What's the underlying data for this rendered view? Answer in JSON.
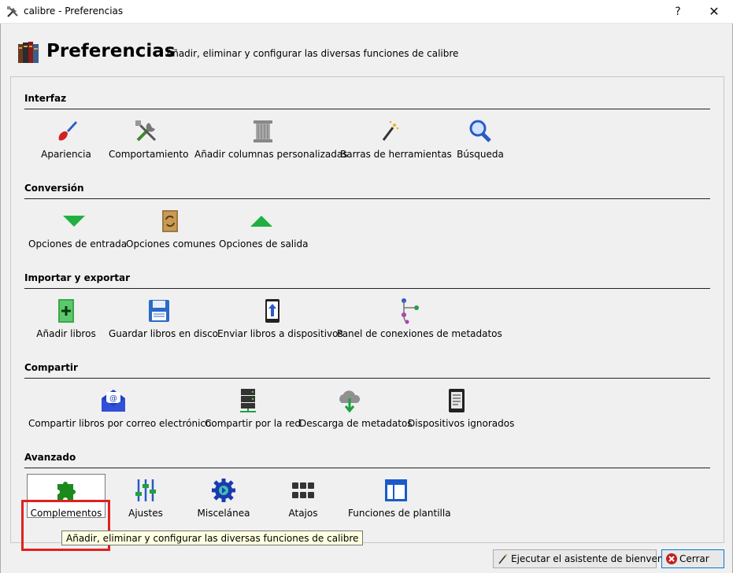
{
  "window": {
    "title": "calibre - Preferencias",
    "help_label": "?",
    "close_label": "✕"
  },
  "header": {
    "heading": "Preferencias",
    "subtitle": "Añadir, eliminar y configurar las diversas funciones de calibre"
  },
  "sections": [
    {
      "title": "Interfaz",
      "items": [
        {
          "label": "Apariencia",
          "icon": "paintbrush-icon"
        },
        {
          "label": "Comportamiento",
          "icon": "tools-icon"
        },
        {
          "label": "Añadir columnas personalizadas",
          "icon": "column-icon"
        },
        {
          "label": "Barras de herramientas",
          "icon": "magic-wand-icon"
        },
        {
          "label": "Búsqueda",
          "icon": "search-icon"
        }
      ]
    },
    {
      "title": "Conversión",
      "items": [
        {
          "label": "Opciones de entrada",
          "icon": "arrow-down-icon"
        },
        {
          "label": "Opciones comunes",
          "icon": "convert-icon"
        },
        {
          "label": "Opciones de salida",
          "icon": "arrow-up-icon"
        }
      ]
    },
    {
      "title": "Importar y exportar",
      "items": [
        {
          "label": "Añadir libros",
          "icon": "add-book-icon"
        },
        {
          "label": "Guardar libros en disco",
          "icon": "floppy-icon"
        },
        {
          "label": "Enviar libros a dispositivos",
          "icon": "send-device-icon"
        },
        {
          "label": "Panel de conexiones de metadatos",
          "icon": "plugboard-icon"
        }
      ]
    },
    {
      "title": "Compartir",
      "items": [
        {
          "label": "Compartir libros por correo electrónico",
          "icon": "email-icon"
        },
        {
          "label": "Compartir por la red",
          "icon": "server-icon"
        },
        {
          "label": "Descarga de metadatos",
          "icon": "cloud-download-icon"
        },
        {
          "label": "Dispositivos ignorados",
          "icon": "device-icon"
        }
      ]
    },
    {
      "title": "Avanzado",
      "items": [
        {
          "label": "Complementos",
          "icon": "puzzle-icon"
        },
        {
          "label": "Ajustes",
          "icon": "sliders-icon"
        },
        {
          "label": "Miscelánea",
          "icon": "gear-icon"
        },
        {
          "label": "Atajos",
          "icon": "keyboard-icon"
        },
        {
          "label": "Funciones de plantilla",
          "icon": "template-icon"
        }
      ]
    }
  ],
  "tooltip": "Añadir, eliminar y configurar las diversas funciones de calibre",
  "footer": {
    "wizard_label": "Ejecutar el asistente de bienvenida",
    "close_label": "Cerrar"
  },
  "colors": {
    "highlight_red": "#e02020",
    "accent_blue": "#0078d7",
    "tooltip_bg": "#ffffe1"
  }
}
